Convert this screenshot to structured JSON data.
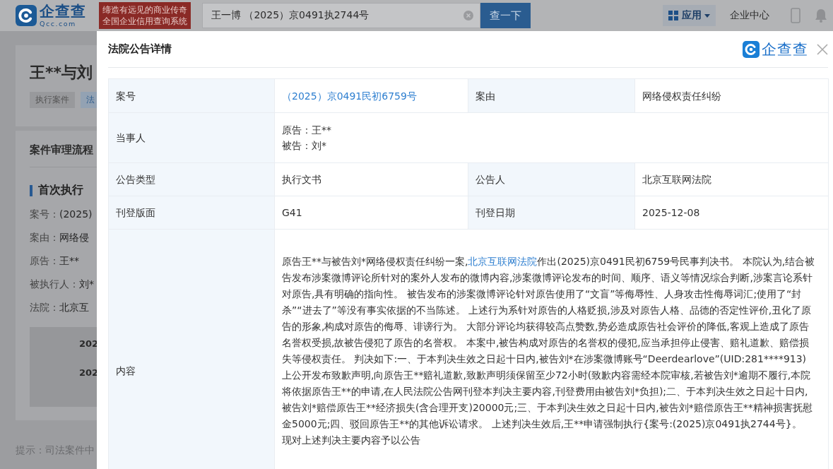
{
  "header": {
    "logo_text": "企查查",
    "logo_domain": "Qcc.com",
    "slogan": [
      "缔造有远见的商业传奇",
      "全国企业信用查询系统"
    ],
    "search": {
      "value": "王一博 （2025）京0491执2744号"
    },
    "search_button": "查一下",
    "apps_menu": "应用",
    "enterprise_center": "企业中心"
  },
  "background_page": {
    "title": "王**与刘",
    "tags": [
      "执行案件",
      "法"
    ],
    "card_title": "案件审理流程",
    "section_title": "首次执行",
    "fields": [
      {
        "label": "案号：",
        "value": "(2025)"
      },
      {
        "label": "案由：",
        "value": "网络侵"
      },
      {
        "label": "原告：",
        "value": "王**"
      },
      {
        "label": "被执行人：",
        "value": "刘*"
      },
      {
        "label": "法院：",
        "value": "北京互"
      }
    ],
    "timeline": [
      "202",
      "202"
    ],
    "hint": "提示：司法案件中"
  },
  "modal": {
    "title": "法院公告详情",
    "logo_text": "企查查",
    "rows": [
      {
        "cells": [
          {
            "kind": "label",
            "text": "案号"
          },
          {
            "kind": "link",
            "text": "（2025）京0491民初6759号"
          },
          {
            "kind": "label",
            "text": "案由"
          },
          {
            "kind": "text",
            "text": "网络侵权责任纠纷"
          }
        ]
      },
      {
        "cells": [
          {
            "kind": "label",
            "text": "当事人"
          },
          {
            "kind": "lines",
            "colspan": 3,
            "lines": [
              "原告：王**",
              "被告：刘*"
            ]
          }
        ]
      },
      {
        "cells": [
          {
            "kind": "label",
            "text": "公告类型"
          },
          {
            "kind": "text",
            "text": "执行文书"
          },
          {
            "kind": "label",
            "text": "公告人"
          },
          {
            "kind": "text",
            "text": "北京互联网法院"
          }
        ]
      },
      {
        "cells": [
          {
            "kind": "label",
            "text": "刊登版面"
          },
          {
            "kind": "text",
            "text": "G41"
          },
          {
            "kind": "label",
            "text": "刊登日期"
          },
          {
            "kind": "text",
            "text": "2025-12-08"
          }
        ]
      },
      {
        "cells": [
          {
            "kind": "label",
            "text": "内容"
          },
          {
            "kind": "content",
            "colspan": 3,
            "before": "原告王**与被告刘*网络侵权责任纠纷一案,",
            "link": "北京互联网法院",
            "after": "作出(2025)京0491民初6759号民事判决书。 本院认为,结合被告发布涉案微博评论所针对的案外人发布的微博内容,涉案微博评论发布的时间、顺序、语义等情况综合判断,涉案言论系针对原告,具有明确的指向性。 被告发布的涉案微博评论针对原告使用了“文盲”等侮辱性、人身攻击性侮辱词汇;使用了“封杀”“进去了”等没有事实依据的不当陈述。 上述行为系针对原告的人格贬损,涉及对原告人格、品德的否定性评价,丑化了原告的形象,构成对原告的侮辱、诽谤行为。 大部分评论均获得较高点赞数,势必造成原告社会评价的降低,客观上造成了原告名誉权受损,故被告侵犯了原告的名誉权。 本案中,被告构成对原告的名誉权的侵犯,应当承担停止侵害、赔礼道歉、赔偿损失等侵权责任。 判决如下:一、于本判决生效之日起十日内,被告刘*在涉案微博账号“Deerdearlove”(UID:281****913)上公开发布致歉声明,向原告王**赔礼道歉,致歉声明须保留至少72小时(致歉内容需经本院审核,若被告刘*逾期不履行,本院将依据原告王**的申请,在人民法院公告网刊登本判决主要内容,刊登费用由被告刘*负担);二、于本判决生效之日起十日内,被告刘*赔偿原告王**经济损失(含合理开支)20000元;三、于本判决生效之日起十日内,被告刘*赔偿原告王**精神损害抚慰金5000元;四、驳回原告王**的其他诉讼请求。 上述判决生效后,王**申请强制执行{案号:(2025)京0491执2744号}。",
            "closing": "现对上述判决主要内容予以公告"
          }
        ]
      }
    ]
  }
}
